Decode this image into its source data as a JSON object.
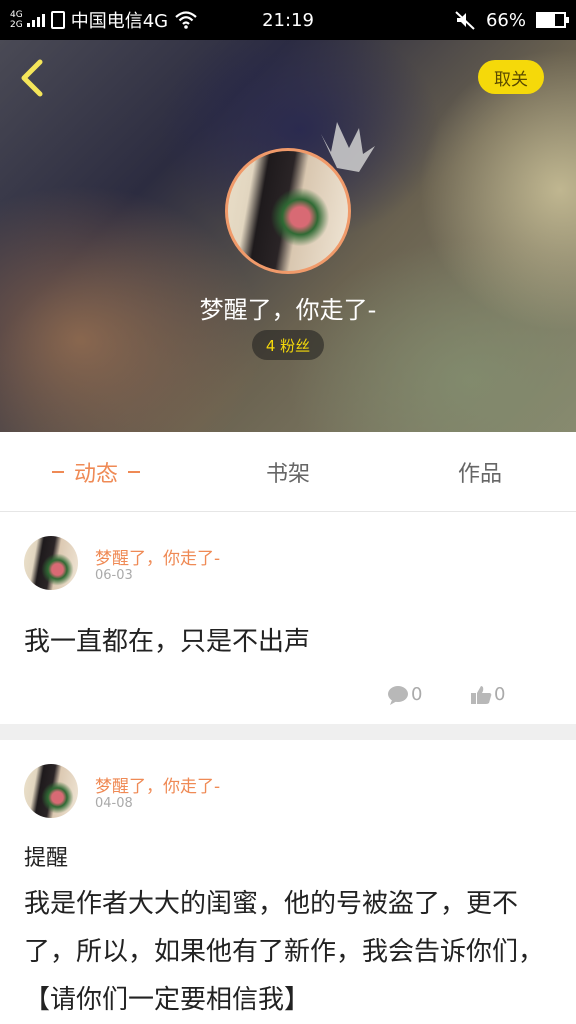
{
  "status_bar": {
    "network_top": "4G",
    "network_bottom": "2G",
    "carrier": "中国电信4G",
    "time": "21:19",
    "battery": "66%",
    "battery_level": 0.66
  },
  "header": {
    "follow_label": "取关",
    "username": "梦醒了，你走了-",
    "fans": "4 粉丝"
  },
  "tabs": [
    {
      "label": "动态",
      "active": true
    },
    {
      "label": "书架",
      "active": false
    },
    {
      "label": "作品",
      "active": false
    }
  ],
  "posts": [
    {
      "author": "梦醒了，你走了-",
      "date": "06-03",
      "text": "我一直都在，只是不出声",
      "comments": "0",
      "likes": "0"
    },
    {
      "author": "梦醒了，你走了-",
      "date": "04-08",
      "title": "提醒",
      "text": "我是作者大大的闺蜜，他的号被盗了，更不了，所以，如果他有了新作，我会告诉你们，【请你们一定要相信我】"
    }
  ],
  "icons": {
    "back": "chevron-left-icon",
    "crown": "crown-icon",
    "comment": "comment-icon",
    "like": "thumbs-up-icon",
    "wifi": "wifi-icon",
    "mute": "mute-icon",
    "battery": "battery-icon"
  },
  "colors": {
    "accent": "#ef8a55",
    "follow_button": "#f5d90a",
    "fans_text": "#f5d90a"
  }
}
